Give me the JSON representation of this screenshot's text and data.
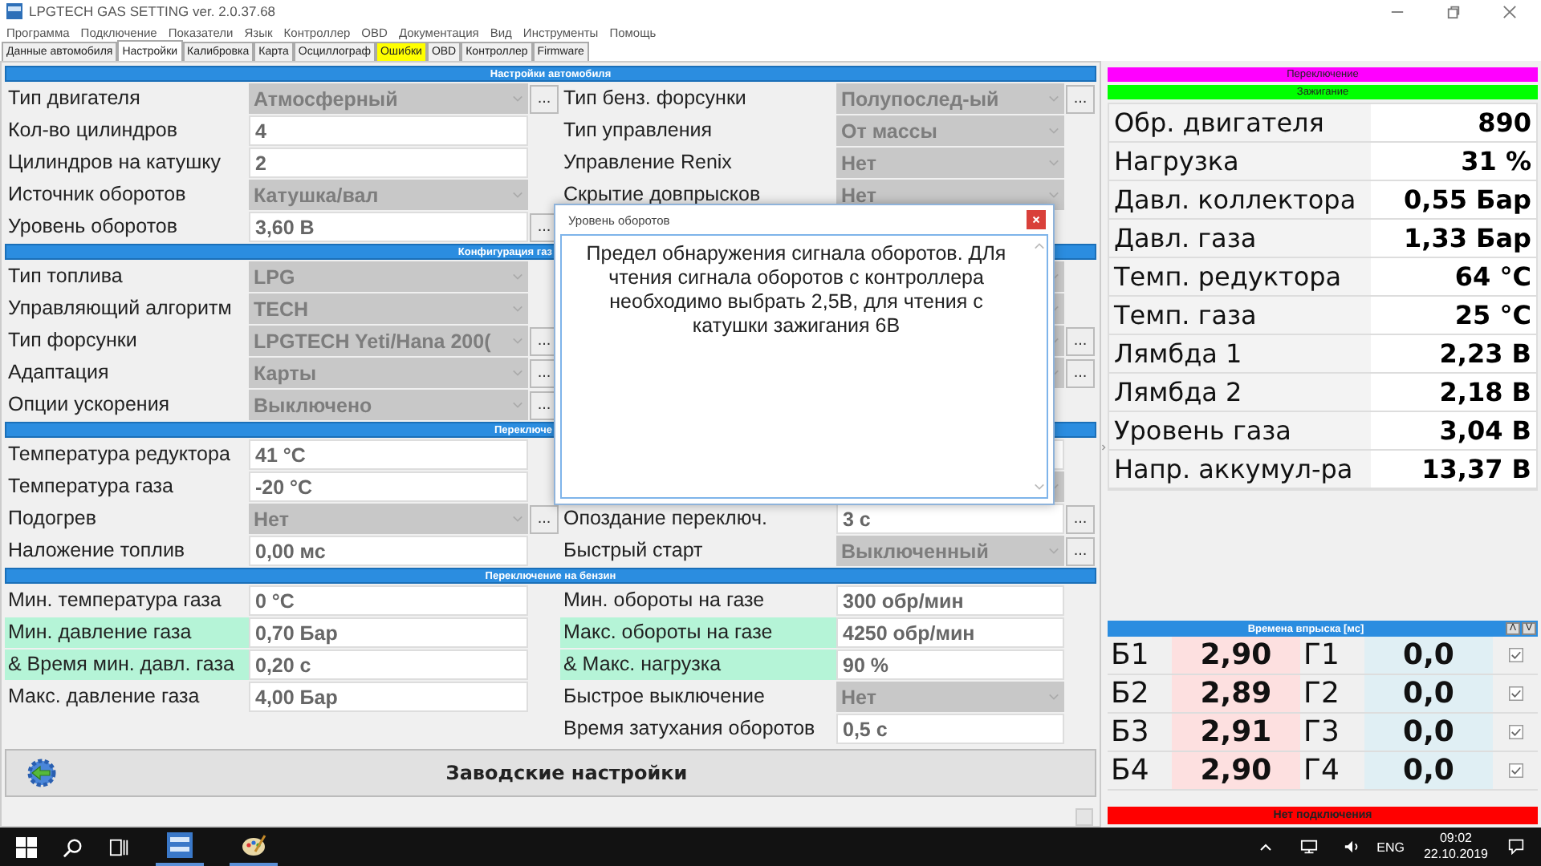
{
  "window": {
    "title": "LPGTECH GAS SETTING ver. 2.0.37.68"
  },
  "menu": [
    "Программа",
    "Подключение",
    "Показатели",
    "Язык",
    "Контроллер",
    "OBD",
    "Документация",
    "Вид",
    "Инструменты",
    "Помощь"
  ],
  "tabs": [
    {
      "label": "Данные автомобиля",
      "selected": false
    },
    {
      "label": "Настройки",
      "selected": true
    },
    {
      "label": "Калибровка",
      "selected": false
    },
    {
      "label": "Карта",
      "selected": false
    },
    {
      "label": "Осциллограф",
      "selected": false
    },
    {
      "label": "Ошибки",
      "selected": false,
      "color": "#ffff00"
    },
    {
      "label": "OBD",
      "selected": false
    },
    {
      "label": "Контроллер",
      "selected": false
    },
    {
      "label": "Firmware",
      "selected": false
    }
  ],
  "sections": [
    {
      "title": "Настройки автомобиля",
      "cut_by_dialog": false,
      "rows": [
        {
          "left": {
            "label": "Тип двигателя",
            "value": "Атмосферный",
            "kind": "dropdown",
            "more_button": "...",
            "highlighted": false
          },
          "right": {
            "label": "Тип бенз. форсунки",
            "value": "Полупослед-ый",
            "kind": "dropdown",
            "more_button": "...",
            "highlighted": false
          }
        },
        {
          "left": {
            "label": "Кол-во цилиндров",
            "value": "4",
            "kind": "input",
            "highlighted": false
          },
          "right": {
            "label": "Тип управления",
            "value": "От массы",
            "kind": "dropdown",
            "highlighted": false
          }
        },
        {
          "left": {
            "label": "Цилиндров на катушку",
            "value": "2",
            "kind": "input",
            "highlighted": false
          },
          "right": {
            "label": "Управление Renix",
            "value": "Нет",
            "kind": "dropdown",
            "highlighted": false
          }
        },
        {
          "left": {
            "label": "Источник оборотов",
            "value": "Катушка/вал",
            "kind": "dropdown",
            "highlighted": false
          },
          "right": {
            "label": "Скрытие довпрысков",
            "value": "Нет",
            "kind": "dropdown",
            "highlighted": false
          }
        },
        {
          "left": {
            "label": "Уровень оборотов",
            "value": "3,60 В",
            "kind": "input",
            "more_button": "...",
            "highlighted": false
          },
          "right": null
        }
      ]
    },
    {
      "title": "Конфигурация газ",
      "cut_by_dialog": true,
      "rows": [
        {
          "left": {
            "label": "Тип топлива",
            "value": "LPG",
            "kind": "dropdown",
            "highlighted": false
          },
          "right": {
            "kind": "dropdown"
          }
        },
        {
          "left": {
            "label": "Управляющий алгоритм",
            "value": "TECH",
            "kind": "dropdown",
            "highlighted": false
          },
          "right": {
            "kind": "dropdown"
          }
        },
        {
          "left": {
            "label": "Тип форсунки",
            "value": "LPGTECH Yeti/Hana 200(",
            "kind": "dropdown",
            "more_button": "...",
            "highlighted": false
          },
          "right": {
            "kind": "dropdown",
            "more_button": "..."
          }
        },
        {
          "left": {
            "label": "Адаптация",
            "value": "Карты",
            "kind": "dropdown",
            "more_button": "...",
            "highlighted": false
          },
          "right": {
            "kind": "dropdown",
            "more_button": "..."
          }
        },
        {
          "left": {
            "label": "Опции ускорения",
            "value": "Выключено",
            "kind": "dropdown",
            "more_button": "...",
            "highlighted": false
          },
          "right": null
        }
      ]
    },
    {
      "title": "Переключе",
      "cut_by_dialog": true,
      "rows": [
        {
          "left": {
            "label": "Температура редуктора",
            "value": "41 °C",
            "kind": "input",
            "highlighted": false
          },
          "right": {
            "kind": "input"
          }
        },
        {
          "left": {
            "label": "Температура газа",
            "value": "-20 °C",
            "kind": "input",
            "highlighted": false
          },
          "right": {
            "kind": "dropdown"
          }
        },
        {
          "left": {
            "label": "Подогрев",
            "value": "Нет",
            "kind": "dropdown",
            "more_button": "...",
            "highlighted": false
          },
          "right": {
            "label": "Опоздание переключ.",
            "value": "3 с",
            "kind": "input",
            "more_button": "...",
            "highlighted": false
          }
        },
        {
          "left": {
            "label": "Наложение топлив",
            "value": "0,00 мс",
            "kind": "input",
            "highlighted": false
          },
          "right": {
            "label": "Быстрый старт",
            "value": "Выключенный",
            "kind": "dropdown",
            "more_button": "...",
            "highlighted": false
          }
        }
      ]
    },
    {
      "title": "Переключение на бензин",
      "cut_by_dialog": false,
      "rows": [
        {
          "left": {
            "label": "Мин. температура газа",
            "value": "0 °C",
            "kind": "input",
            "highlighted": false
          },
          "right": {
            "label": "Мин. обороты на газе",
            "value": "300 обр/мин",
            "kind": "input",
            "highlighted": false
          }
        },
        {
          "left": {
            "label": "Мин. давление газа",
            "value": "0,70 Бар",
            "kind": "input",
            "highlighted": true
          },
          "right": {
            "label": "Макс. обороты на газе",
            "value": "4250 обр/мин",
            "kind": "input",
            "highlighted": true
          }
        },
        {
          "left": {
            "label": "& Время мин. давл. газа",
            "value": "0,20 с",
            "kind": "input",
            "highlighted": true
          },
          "right": {
            "label": "& Макс. нагрузка",
            "value": "90 %",
            "kind": "input",
            "highlighted": true
          }
        },
        {
          "left": {
            "label": "Макс. давление газа",
            "value": "4,00 Бар",
            "kind": "input",
            "highlighted": false
          },
          "right": {
            "label": "Быстрое выключение",
            "value": "Нет",
            "kind": "dropdown",
            "highlighted": false
          }
        },
        {
          "left": null,
          "right": {
            "label": "Время затухания оборотов",
            "value": "0,5 с",
            "kind": "input",
            "highlighted": false
          }
        }
      ]
    }
  ],
  "factory_button": "Заводские настройки",
  "status_bars": [
    {
      "label": "Переключение",
      "color": "#ff00ff"
    },
    {
      "label": "Зажигание",
      "color": "#00ff00"
    }
  ],
  "readings": [
    {
      "label": "Обр. двигателя",
      "value": "890"
    },
    {
      "label": "Нагрузка",
      "value": "31 %"
    },
    {
      "label": "Давл. коллектора",
      "value": "0,55 Бар"
    },
    {
      "label": "Давл. газа",
      "value": "1,33 Бар"
    },
    {
      "label": "Темп. редуктора",
      "value": "64 °C"
    },
    {
      "label": "Темп. газа",
      "value": "25 °C"
    },
    {
      "label": "Лямбда 1",
      "value": "2,23 В"
    },
    {
      "label": "Лямбда 2",
      "value": "2,18 В"
    },
    {
      "label": "Уровень газа",
      "value": "3,04 В"
    },
    {
      "label": "Напр. аккумул-ра",
      "value": "13,37 В"
    }
  ],
  "injection": {
    "title": "Времена впрыска [мс]",
    "buttons": [
      "Λ",
      "V"
    ],
    "rows": [
      {
        "petrol_label": "Б1",
        "petrol": "2,90",
        "gas_label": "Г1",
        "gas": "0,0",
        "checked": true
      },
      {
        "petrol_label": "Б2",
        "petrol": "2,89",
        "gas_label": "Г2",
        "gas": "0,0",
        "checked": true
      },
      {
        "petrol_label": "Б3",
        "petrol": "2,91",
        "gas_label": "Г3",
        "gas": "0,0",
        "checked": true
      },
      {
        "petrol_label": "Б4",
        "petrol": "2,90",
        "gas_label": "Г4",
        "gas": "0,0",
        "checked": true
      }
    ]
  },
  "connection": {
    "label": "Нет подключения",
    "color": "#ff0000"
  },
  "dialog": {
    "title": "Уровень оборотов",
    "text": "Предел обнаружения сигнала оборотов. ДЛя чтения сигнала оборотов с контроллера необходимо выбрать 2,5В, для чтения с катушки зажигания 6В"
  },
  "taskbar": {
    "language": "ENG",
    "time": "09:02",
    "date": "22.10.2019"
  }
}
